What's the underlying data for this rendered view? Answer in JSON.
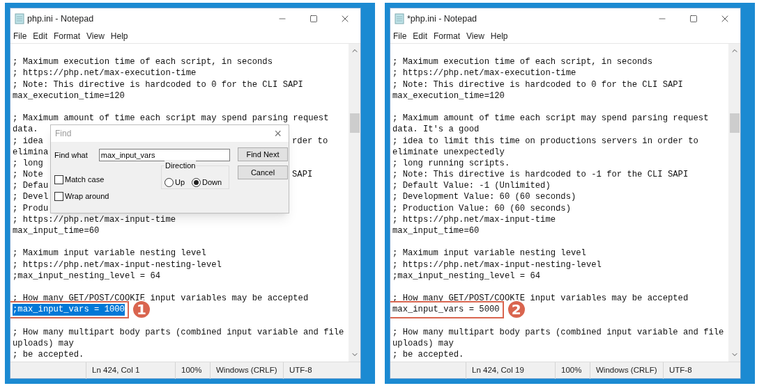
{
  "windows": [
    {
      "title": "php.ini - Notepad",
      "menu": [
        "File",
        "Edit",
        "Format",
        "View",
        "Help"
      ],
      "lines": [
        {
          "kind": "blank"
        },
        {
          "kind": "text",
          "text": "; Maximum execution time of each script, in seconds"
        },
        {
          "kind": "text",
          "text": "; https://php.net/max-execution-time"
        },
        {
          "kind": "text",
          "text": "; Note: This directive is hardcoded to 0 for the CLI SAPI"
        },
        {
          "kind": "text",
          "text": "max_execution_time=120"
        },
        {
          "kind": "blank"
        },
        {
          "kind": "text",
          "text": "; Maximum amount of time each script may spend parsing request"
        },
        {
          "kind": "text",
          "text": "data."
        },
        {
          "kind": "text",
          "text": "; idea",
          "tail": "rder to"
        },
        {
          "kind": "text",
          "text": "elimina"
        },
        {
          "kind": "text",
          "text": "; long"
        },
        {
          "kind": "text",
          "text": "; Note",
          "tail": "SAPI"
        },
        {
          "kind": "text",
          "text": "; Defau"
        },
        {
          "kind": "text",
          "text": "; Devel"
        },
        {
          "kind": "text",
          "text": "; Produ"
        },
        {
          "kind": "text",
          "text": "; https://php.net/max-input-time"
        },
        {
          "kind": "text",
          "text": "max_input_time=60"
        },
        {
          "kind": "blank"
        },
        {
          "kind": "text",
          "text": "; Maximum input variable nesting level"
        },
        {
          "kind": "text",
          "text": "; https://php.net/max-input-nesting-level"
        },
        {
          "kind": "text",
          "text": ";max_input_nesting_level = 64"
        },
        {
          "kind": "blank"
        },
        {
          "kind": "text",
          "text": "; How many GET/POST/COOKIE input variables may be accepted"
        },
        {
          "kind": "marked",
          "text": ";max_input_vars = 1000",
          "selected": true,
          "badge": "1"
        },
        {
          "kind": "blank"
        },
        {
          "kind": "text",
          "text": "; How many multipart body parts (combined input variable and file"
        },
        {
          "kind": "text",
          "text": "uploads) may"
        },
        {
          "kind": "text",
          "text": "; be accepted."
        }
      ],
      "find_dialog": {
        "title": "Find",
        "close": "×",
        "find_what_label": "Find what",
        "find_what_value": "max_input_vars",
        "buttons": [
          "Find Next",
          "Cancel"
        ],
        "direction_label": "Direction",
        "directions": [
          {
            "label": "Up",
            "selected": false
          },
          {
            "label": "Down",
            "selected": true
          }
        ],
        "options": [
          {
            "label": "Match case",
            "checked": false
          },
          {
            "label": "Wrap around",
            "checked": false
          }
        ]
      },
      "status": [
        "Ln 424, Col 1",
        "100%",
        "Windows (CRLF)",
        "UTF-8"
      ]
    },
    {
      "title": "*php.ini - Notepad",
      "menu": [
        "File",
        "Edit",
        "Format",
        "View",
        "Help"
      ],
      "lines": [
        {
          "kind": "blank"
        },
        {
          "kind": "text",
          "text": "; Maximum execution time of each script, in seconds"
        },
        {
          "kind": "text",
          "text": "; https://php.net/max-execution-time"
        },
        {
          "kind": "text",
          "text": "; Note: This directive is hardcoded to 0 for the CLI SAPI"
        },
        {
          "kind": "text",
          "text": "max_execution_time=120"
        },
        {
          "kind": "blank"
        },
        {
          "kind": "text",
          "text": "; Maximum amount of time each script may spend parsing request"
        },
        {
          "kind": "text",
          "text": "data. It's a good"
        },
        {
          "kind": "text",
          "text": "; idea to limit this time on productions servers in order to"
        },
        {
          "kind": "text",
          "text": "eliminate unexpectedly"
        },
        {
          "kind": "text",
          "text": "; long running scripts."
        },
        {
          "kind": "text",
          "text": "; Note: This directive is hardcoded to -1 for the CLI SAPI"
        },
        {
          "kind": "text",
          "text": "; Default Value: -1 (Unlimited)"
        },
        {
          "kind": "text",
          "text": "; Development Value: 60 (60 seconds)"
        },
        {
          "kind": "text",
          "text": "; Production Value: 60 (60 seconds)"
        },
        {
          "kind": "text",
          "text": "; https://php.net/max-input-time"
        },
        {
          "kind": "text",
          "text": "max_input_time=60"
        },
        {
          "kind": "blank"
        },
        {
          "kind": "text",
          "text": "; Maximum input variable nesting level"
        },
        {
          "kind": "text",
          "text": "; https://php.net/max-input-nesting-level"
        },
        {
          "kind": "text",
          "text": ";max_input_nesting_level = 64"
        },
        {
          "kind": "blank"
        },
        {
          "kind": "text",
          "text": "; How many GET/POST/COOKIE input variables may be accepted"
        },
        {
          "kind": "marked",
          "text": "max_input_vars = 5000",
          "selected": false,
          "badge": "2"
        },
        {
          "kind": "blank"
        },
        {
          "kind": "text",
          "text": "; How many multipart body parts (combined input variable and file"
        },
        {
          "kind": "text",
          "text": "uploads) may"
        },
        {
          "kind": "text",
          "text": "; be accepted."
        }
      ],
      "status": [
        "Ln 424, Col 19",
        "100%",
        "Windows (CRLF)",
        "UTF-8"
      ]
    }
  ]
}
